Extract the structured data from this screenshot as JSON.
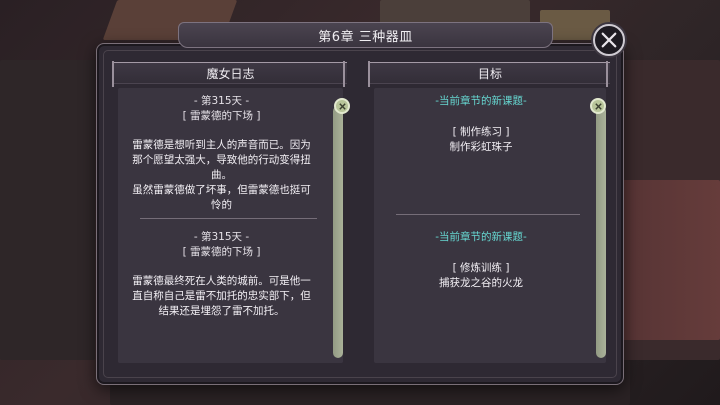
{
  "header": {
    "title": "第6章  三种器皿"
  },
  "journal": {
    "heading": "魔女日志",
    "entries": [
      {
        "day": "- 第315天 -",
        "subtitle": "[ 雷蒙德的下场 ]",
        "text": "雷蒙德是想听到主人的声音而已。因为那个愿望太强大，导致他的行动变得扭曲。",
        "text2": "虽然雷蒙德做了坏事，但雷蒙德也挺可怜的"
      },
      {
        "day": "- 第315天 -",
        "subtitle": "[ 雷蒙德的下场 ]",
        "text": "雷蒙德最终死在人类的城前。可是他一直自称自己是雷不加托的忠实部下，但结果还是埋怨了雷不加托。"
      }
    ]
  },
  "objectives": {
    "heading": "目标",
    "items": [
      {
        "title": "-当前章节的新课题-",
        "category": "[ 制作练习 ]",
        "task": "制作彩虹珠子"
      },
      {
        "title": "-当前章节的新课题-",
        "category": "[ 修炼训练 ]",
        "task": "捕获龙之谷的火龙"
      }
    ]
  },
  "icons": {
    "close": "close-icon",
    "scroll_cap": "close-small-icon"
  },
  "colors": {
    "goal_title": "#66d7d1",
    "scroll_cap": "#b8c59a",
    "panel": "#2e2933"
  }
}
